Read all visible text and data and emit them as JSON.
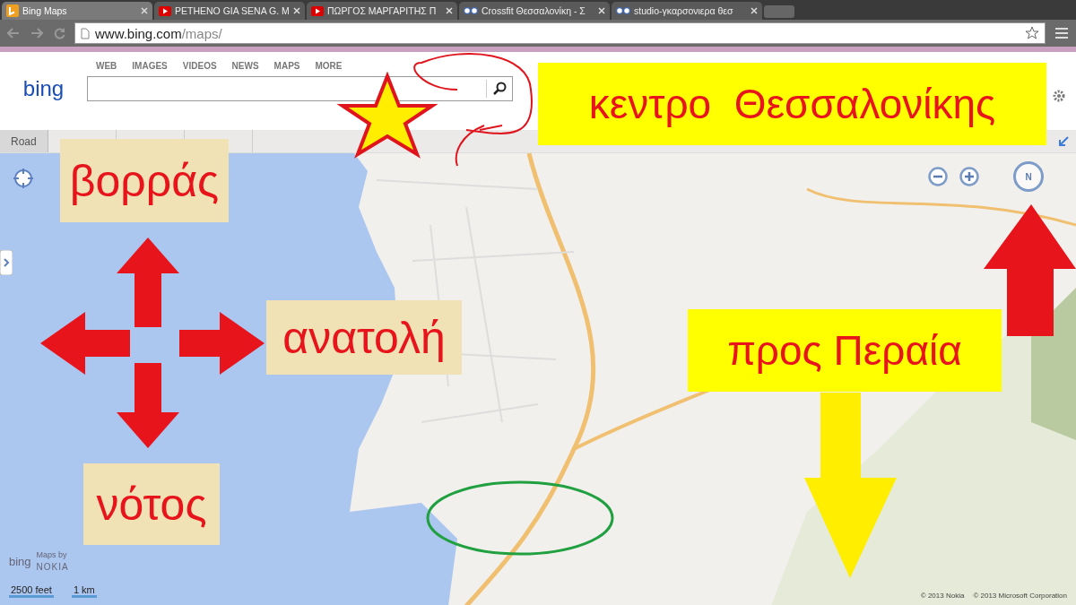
{
  "browser": {
    "tabs": [
      {
        "title": "Bing Maps",
        "kind": "bing",
        "selected": true
      },
      {
        "title": "PETHENO GIA SENA G. M",
        "kind": "video",
        "selected": false
      },
      {
        "title": "ΠΩΡΓΟΣ ΜΑΡΓΑΡΙΤΗΣ Π",
        "kind": "video",
        "selected": false
      },
      {
        "title": "Crossfit Θεσσαλονίκη - Σ",
        "kind": "site",
        "selected": false
      },
      {
        "title": "studio-γκαρσονιερα θεσ",
        "kind": "site",
        "selected": false
      }
    ],
    "address": {
      "host": "www.bing.com",
      "path": "/maps/"
    }
  },
  "header": {
    "logo": "bing",
    "nav": [
      "WEB",
      "IMAGES",
      "VIDEOS",
      "NEWS",
      "MAPS",
      "MORE"
    ]
  },
  "toolbar": {
    "view": "Road"
  },
  "map": {
    "compass_label": "N",
    "attribution": {
      "logo": "bing",
      "provider_caption": "Maps by",
      "provider": "NOKIA"
    },
    "scale": [
      "2500 feet",
      "1 km"
    ],
    "copyright": [
      "© 2013 Nokia",
      "© 2013 Microsoft Corporation"
    ]
  },
  "annotations": [
    {
      "text": "κεντρο  Θεσσαλονίκης",
      "kind": "yellow"
    },
    {
      "text": "βορράς",
      "kind": "tan"
    },
    {
      "text": "ανατολή",
      "kind": "tan"
    },
    {
      "text": "νότος",
      "kind": "tan"
    },
    {
      "text": "προς Περαία",
      "kind": "yellow"
    }
  ]
}
